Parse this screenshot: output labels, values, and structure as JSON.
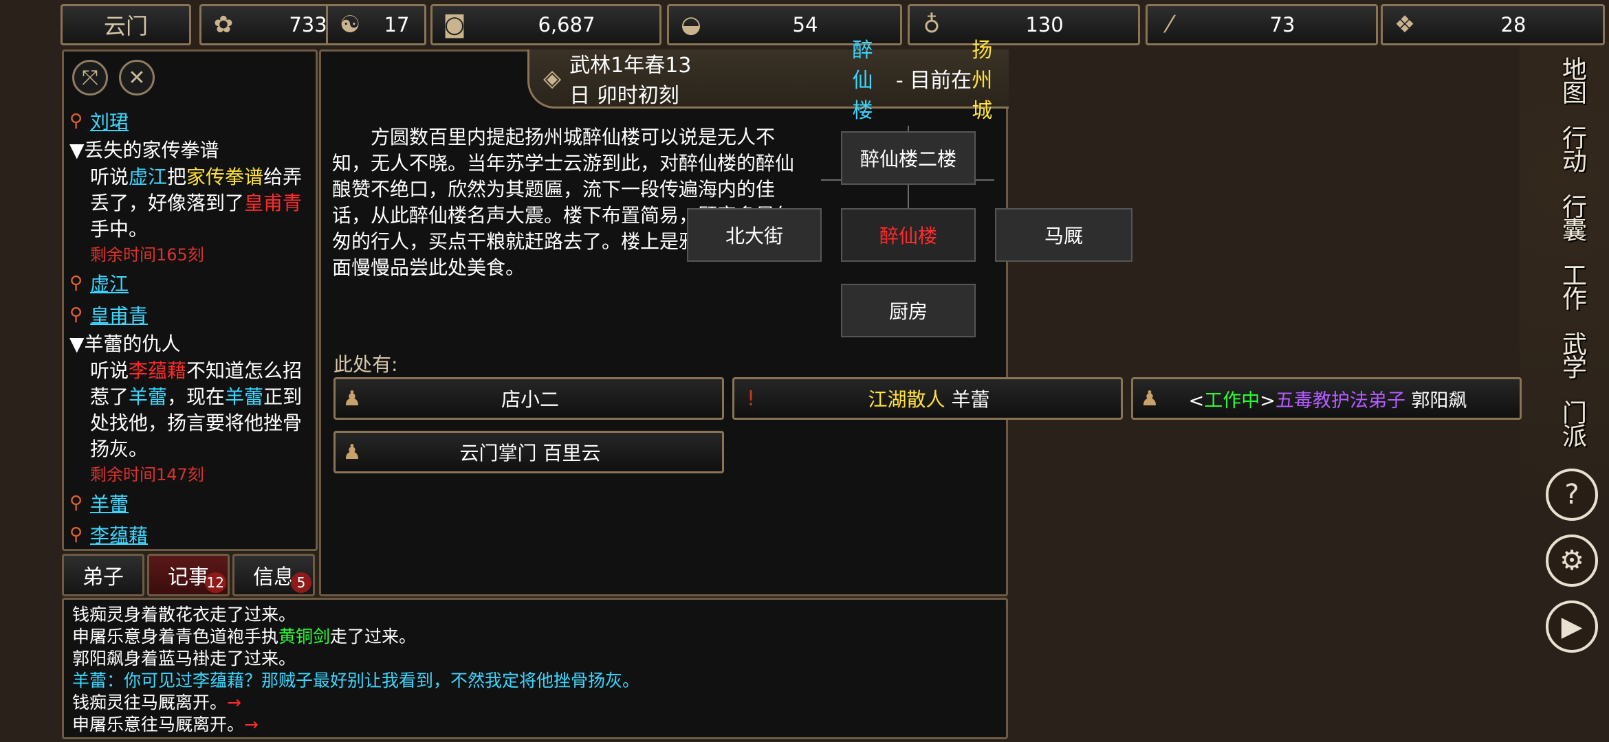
{
  "topbar": {
    "sect": "云门",
    "resources": [
      {
        "icon": "reputation-icon",
        "value": "733"
      },
      {
        "icon": "yin-yang-icon",
        "value": "17"
      },
      {
        "icon": "coin-icon",
        "value": "6,687"
      },
      {
        "icon": "food-bowl-icon",
        "value": "54"
      },
      {
        "icon": "gourd-icon",
        "value": "130"
      },
      {
        "icon": "scroll-icon",
        "value": "73"
      },
      {
        "icon": "ore-icon",
        "value": "28"
      }
    ]
  },
  "quests": {
    "person1": "刘珺",
    "q1": {
      "title": "▼丢失的家传拳谱",
      "p1": "听说",
      "n1": "虚江",
      "p2": "把",
      "item": "家传拳谱",
      "p3": "给弄丢了，好像落到了",
      "n2": "皇甫青",
      "p4": "手中。",
      "time": "剩余时间165刻"
    },
    "person2": "虚江",
    "person3": "皇甫青",
    "q2": {
      "title": "▼羊蕾的仇人",
      "p1": "听说",
      "n1": "李蕴藉",
      "p2": "不知道怎么招惹了",
      "n2": "羊蕾",
      "p3": "，现在",
      "n3": "羊蕾",
      "p4": "正到处找他，扬言要将他挫骨扬灰。",
      "time": "剩余时间147刻"
    },
    "person4": "羊蕾",
    "person5": "李蕴藉"
  },
  "tabs": {
    "disciples": "弟子",
    "journal": "记事",
    "journal_badge": "12",
    "info": "信息",
    "info_badge": "5"
  },
  "header": {
    "date": "武林1年春13日 卯时初刻",
    "place": "醉仙楼",
    "sep": " - 目前在",
    "city": "扬州城"
  },
  "description": "方圆数百里内提起扬州城醉仙楼可以说是无人不知，无人不晓。当年苏学士云游到此，对醉仙楼的醉仙酿赞不绝口，欣然为其题匾，流下一段传遍海内的佳话，从此醉仙楼名声大震。楼下布置简易，顾客多是匆匆的行人，买点干粮就赶路去了。楼上是雅座，可在上面慢慢品尝此处美食。",
  "minimap": {
    "north": "醉仙楼二楼",
    "west": "北大街",
    "center": "醉仙楼",
    "east": "马厩",
    "south": "厨房"
  },
  "here": {
    "label": "此处有:",
    "npc1": "店小二",
    "npc2_title": "江湖散人",
    "npc2_name": "羊蕾",
    "npc3_open": "<",
    "npc3_status": "工作中",
    "npc3_close": ">",
    "npc3_title": "五毒教护法弟子",
    "npc3_name": "郭阳飙",
    "npc4": "云门掌门 百里云"
  },
  "log": {
    "l1": "钱痴灵身着散花衣走了过来。",
    "l2a": "申屠乐意身着青色道袍手执",
    "l2b": "黄铜剑",
    "l2c": "走了过来。",
    "l3": "郭阳飙身着蓝马褂走了过来。",
    "l4": "羊蕾：你可见过李蕴藉？那贼子最好别让我看到，不然我定将他挫骨扬灰。",
    "l5": "钱痴灵往马厩离开。",
    "l6": "申屠乐意往马厩离开。",
    "arrow": "→"
  },
  "rightmenu": {
    "map": "地图",
    "action": "行动",
    "bag": "行囊",
    "work": "工作",
    "martial": "武学",
    "sect": "门派",
    "help": "?",
    "settings": "⚙",
    "play": "▶"
  },
  "colors": {
    "cyan": "#3ad7ff",
    "yellow": "#ffe33a",
    "red": "#ff2a2a",
    "green": "#2cff3a",
    "purple": "#b45cff",
    "border": "#8a7456"
  }
}
